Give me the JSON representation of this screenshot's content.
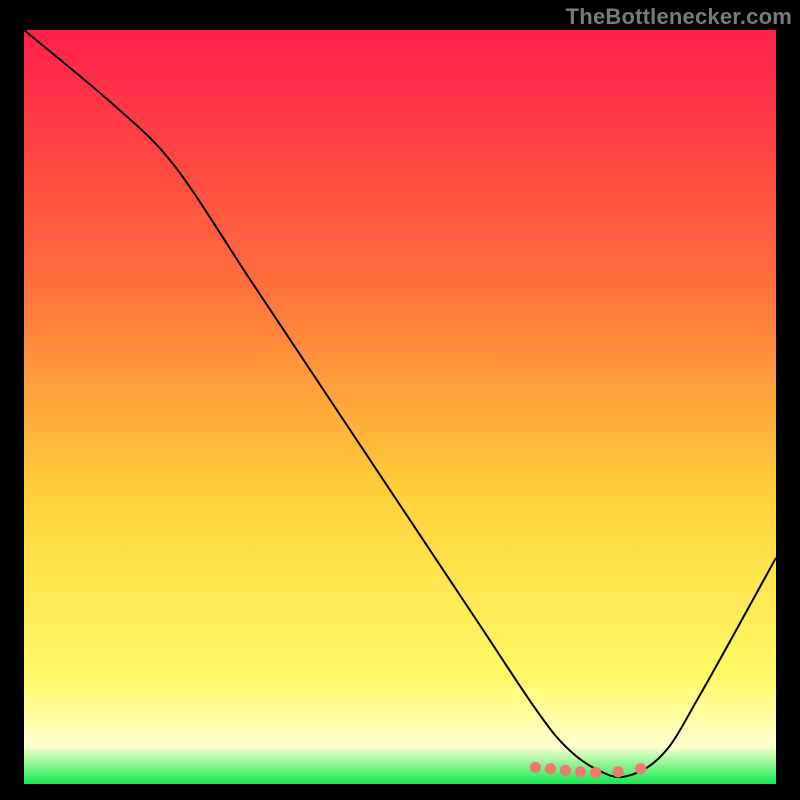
{
  "watermark": "TheBottlenecker.com",
  "colors": {
    "gradient_top": "#ff1f4b",
    "gradient_mid1": "#ff6a3c",
    "gradient_mid2": "#ffd23a",
    "gradient_low": "#fffb68",
    "gradient_pale": "#ffffd0",
    "gradient_bottom": "#14e84f",
    "curve": "#000000",
    "dots": "#f07a6f",
    "page_bg": "#000000"
  },
  "chart_data": {
    "type": "line",
    "title": "",
    "xlabel": "",
    "ylabel": "",
    "xlim": [
      0,
      100
    ],
    "ylim": [
      0,
      100
    ],
    "series": [
      {
        "name": "curve",
        "x": [
          0,
          12,
          20,
          30,
          40,
          50,
          60,
          68,
          72,
          76,
          80,
          85,
          90,
          100
        ],
        "values": [
          100,
          90,
          82,
          67,
          52,
          37,
          22,
          10,
          5,
          2,
          1,
          4,
          12,
          30
        ]
      }
    ],
    "markers": {
      "x": [
        68,
        70,
        72,
        74,
        76,
        79,
        82
      ],
      "y": [
        2.2,
        2.0,
        1.8,
        1.6,
        1.5,
        1.6,
        2.0
      ]
    }
  }
}
